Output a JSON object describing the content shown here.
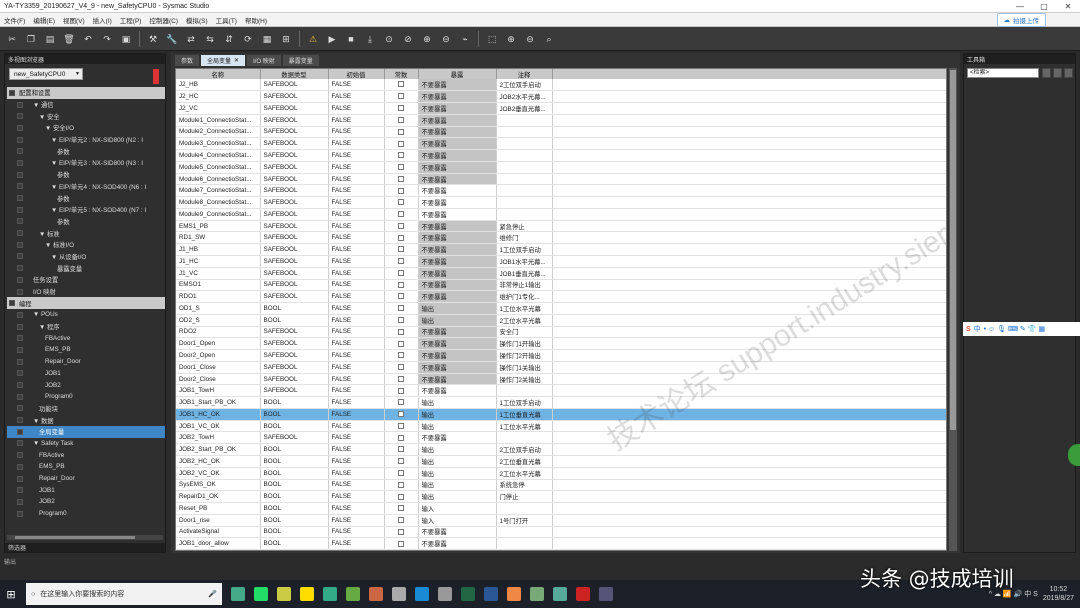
{
  "window": {
    "title": "YA-TY3359_20190627_V4_9 - new_SafetyCPU0 - Sysmac Studio",
    "controls": [
      "—",
      "▢",
      "✕"
    ]
  },
  "menu": {
    "items": [
      "文件(F)",
      "编辑(E)",
      "视图(V)",
      "插入(I)",
      "工程(P)",
      "控制器(C)",
      "模拟(S)",
      "工具(T)",
      "帮助(H)"
    ],
    "upload_label": "拍摄上传"
  },
  "left_panel": {
    "title": "多视图浏览器",
    "device": "new_SafetyCPU0",
    "tree": [
      {
        "label": "配置和设置",
        "type": "sect"
      },
      {
        "label": "▼ 通信",
        "indent": 1
      },
      {
        "label": "▼ 安全",
        "indent": 2
      },
      {
        "label": "▼ 安全I/O",
        "indent": 3
      },
      {
        "label": "▼ EIP/单元2 : NX-SID800 (N2 : I",
        "indent": 4
      },
      {
        "label": "参数",
        "indent": 5
      },
      {
        "label": "▼ EIP/单元3 : NX-SID800 (N3 : I",
        "indent": 4
      },
      {
        "label": "参数",
        "indent": 5
      },
      {
        "label": "▼ EIP/单元4 : NX-SOD400 (N6 : I",
        "indent": 4
      },
      {
        "label": "参数",
        "indent": 5
      },
      {
        "label": "▼ EIP/单元5 : NX-SOD400 (N7 : I",
        "indent": 4
      },
      {
        "label": "参数",
        "indent": 5
      },
      {
        "label": "▼ 标准",
        "indent": 2
      },
      {
        "label": "▼ 标准I/O",
        "indent": 3
      },
      {
        "label": "▼ 从设备I/O",
        "indent": 4
      },
      {
        "label": "暴露变量",
        "indent": 5
      },
      {
        "label": "任务设置",
        "indent": 1
      },
      {
        "label": "I/O 映射",
        "indent": 1
      },
      {
        "label": "编程",
        "type": "sect"
      },
      {
        "label": "▼ POUs",
        "indent": 1
      },
      {
        "label": "▼ 程序",
        "indent": 2
      },
      {
        "label": "FBActive",
        "indent": 3
      },
      {
        "label": "EMS_PB",
        "indent": 3
      },
      {
        "label": "Repair_Door",
        "indent": 3
      },
      {
        "label": "JOB1",
        "indent": 3
      },
      {
        "label": "JOB2",
        "indent": 3
      },
      {
        "label": "Program0",
        "indent": 3
      },
      {
        "label": "功能块",
        "indent": 2
      },
      {
        "label": "▼ 数据",
        "indent": 1
      },
      {
        "label": "全局变量",
        "indent": 2,
        "selected": true
      },
      {
        "label": "▼ Safety Task",
        "indent": 1
      },
      {
        "label": "FBActive",
        "indent": 2
      },
      {
        "label": "EMS_PB",
        "indent": 2
      },
      {
        "label": "Repair_Door",
        "indent": 2
      },
      {
        "label": "JOB1",
        "indent": 2
      },
      {
        "label": "JOB2",
        "indent": 2
      },
      {
        "label": "Program0",
        "indent": 2
      }
    ],
    "footer": "筛选器"
  },
  "tabs": [
    {
      "label": "参数",
      "active": false
    },
    {
      "label": "全局变量",
      "active": true,
      "close": "✕"
    },
    {
      "label": "I/O 映射",
      "active": false
    },
    {
      "label": "暴露变量",
      "active": false
    }
  ],
  "table": {
    "headers": [
      "名称",
      "数据类型",
      "初始值",
      "常数",
      "暴露",
      "注释"
    ],
    "rows": [
      [
        "J2_HB",
        "SAFEBOOL",
        "FALSE",
        "",
        "不要暴露",
        "2工位双手启动"
      ],
      [
        "J2_HC",
        "SAFEBOOL",
        "FALSE",
        "",
        "不要暴露",
        "JOB2水平光幕..."
      ],
      [
        "J2_VC",
        "SAFEBOOL",
        "FALSE",
        "",
        "不要暴露",
        "JOB2垂直光幕..."
      ],
      [
        "Module1_ConnectioStat...",
        "SAFEBOOL",
        "FALSE",
        "",
        "不要暴露",
        ""
      ],
      [
        "Module2_ConnectioStat...",
        "SAFEBOOL",
        "FALSE",
        "",
        "不要暴露",
        ""
      ],
      [
        "Module3_ConnectioStat...",
        "SAFEBOOL",
        "FALSE",
        "",
        "不要暴露",
        ""
      ],
      [
        "Module4_ConnectioStat...",
        "SAFEBOOL",
        "FALSE",
        "",
        "不要暴露",
        ""
      ],
      [
        "Module5_ConnectioStat...",
        "SAFEBOOL",
        "FALSE",
        "",
        "不要暴露",
        ""
      ],
      [
        "Module6_ConnectioStat...",
        "SAFEBOOL",
        "FALSE",
        "",
        "不要暴露",
        ""
      ],
      [
        "Module7_ConnectioStat...",
        "SAFEBOOL",
        "FALSE",
        "",
        "不要暴露",
        ""
      ],
      [
        "Module8_ConnectioStat...",
        "SAFEBOOL",
        "FALSE",
        "",
        "不要暴露",
        ""
      ],
      [
        "Module9_ConnectioStat...",
        "SAFEBOOL",
        "FALSE",
        "",
        "不要暴露",
        ""
      ],
      [
        "EMS1_PB",
        "SAFEBOOL",
        "FALSE",
        "",
        "不要暴露",
        "紧急停止"
      ],
      [
        "RD1_SW",
        "SAFEBOOL",
        "FALSE",
        "",
        "不要暴露",
        "维修门"
      ],
      [
        "J1_HB",
        "SAFEBOOL",
        "FALSE",
        "",
        "不要暴露",
        "1工位双手启动"
      ],
      [
        "J1_HC",
        "SAFEBOOL",
        "FALSE",
        "",
        "不要暴露",
        "JOB1水平光幕..."
      ],
      [
        "J1_VC",
        "SAFEBOOL",
        "FALSE",
        "",
        "不要暴露",
        "JOB1垂直光幕..."
      ],
      [
        "EMSO1",
        "SAFEBOOL",
        "FALSE",
        "",
        "不要暴露",
        "非常停止1输出"
      ],
      [
        "RDO1",
        "SAFEBOOL",
        "FALSE",
        "",
        "不要暴露",
        "维护门1专化..."
      ],
      [
        "OD1_S",
        "BOOL",
        "FALSE",
        "",
        "输出",
        "1工位水平光幕"
      ],
      [
        "OD2_S",
        "BOOL",
        "FALSE",
        "",
        "输出",
        "2工位水平光幕"
      ],
      [
        "RDO2",
        "SAFEBOOL",
        "FALSE",
        "",
        "不要暴露",
        "安全门"
      ],
      [
        "Door1_Open",
        "SAFEBOOL",
        "FALSE",
        "",
        "不要暴露",
        "操作门1开输出"
      ],
      [
        "Door2_Open",
        "SAFEBOOL",
        "FALSE",
        "",
        "不要暴露",
        "操作门2开输出"
      ],
      [
        "Door1_Close",
        "SAFEBOOL",
        "FALSE",
        "",
        "不要暴露",
        "操作门1关输出"
      ],
      [
        "Door2_Close",
        "SAFEBOOL",
        "FALSE",
        "",
        "不要暴露",
        "操作门2关输出"
      ],
      [
        "JOB1_TowH",
        "SAFEBOOL",
        "FALSE",
        "",
        "不要暴露",
        ""
      ],
      [
        "JOB1_Start_PB_OK",
        "BOOL",
        "FALSE",
        "",
        "输出",
        "1工位双手启动"
      ],
      [
        "JOB1_HC_OK",
        "BOOL",
        "FALSE",
        "",
        "输出",
        "1工位垂直光幕"
      ],
      [
        "JOB1_VC_OK",
        "BOOL",
        "FALSE",
        "",
        "输出",
        "1工位水平光幕"
      ],
      [
        "JOB2_TowH",
        "SAFEBOOL",
        "FALSE",
        "",
        "不要暴露",
        ""
      ],
      [
        "JOB2_Start_PB_OK",
        "BOOL",
        "FALSE",
        "",
        "输出",
        "2工位双手启动"
      ],
      [
        "JOB2_HC_OK",
        "BOOL",
        "FALSE",
        "",
        "输出",
        "2工位垂直光幕"
      ],
      [
        "JOB2_VC_OK",
        "BOOL",
        "FALSE",
        "",
        "输出",
        "2工位水平光幕"
      ],
      [
        "SysEMS_OK",
        "BOOL",
        "FALSE",
        "",
        "输出",
        "系统急停"
      ],
      [
        "RepairD1_OK",
        "BOOL",
        "FALSE",
        "",
        "输出",
        "门停止"
      ],
      [
        "Reset_PB",
        "BOOL",
        "FALSE",
        "",
        "输入",
        ""
      ],
      [
        "Door1_rise",
        "BOOL",
        "FALSE",
        "",
        "输入",
        "1号门打开"
      ],
      [
        "ActivateSignal",
        "BOOL",
        "FALSE",
        "",
        "不要暴露",
        ""
      ],
      [
        "JOB1_door_allow",
        "BOOL",
        "FALSE",
        "",
        "不要暴露",
        ""
      ]
    ],
    "selected_row": 28,
    "shaded_expose_rows": [
      0,
      1,
      2,
      3,
      4,
      5,
      6,
      7,
      8,
      12,
      13,
      14,
      15,
      16,
      17,
      18,
      19,
      20,
      21,
      22,
      23,
      24,
      25
    ]
  },
  "watermark": "技术论坛 support.industry.siemens.com/cs",
  "right_panel": {
    "title": "工具箱",
    "search_placeholder": "<检索>"
  },
  "ime": {
    "logo": "S",
    "lang": "中",
    "icons": "• ☺ 🎙 ⌨ ✎ 👕 ▦"
  },
  "lower_panel": "输出",
  "taskbar": {
    "search_placeholder": "在这里输入你要搜索的内容",
    "apps": [
      "#4a8",
      "#2d6",
      "#cc4",
      "#fd0",
      "#3a8",
      "#6a4",
      "#c64",
      "#aaa",
      "#1a8ad4",
      "#999",
      "#264",
      "#2b5797",
      "#e84",
      "#7a7",
      "#5a9",
      "#c22",
      "#557"
    ],
    "tray": "^ ☁ 📶 🔊 中 S",
    "time": "10:52",
    "date": "2019/8/27"
  },
  "corner_watermark": "头条 @技成培训"
}
